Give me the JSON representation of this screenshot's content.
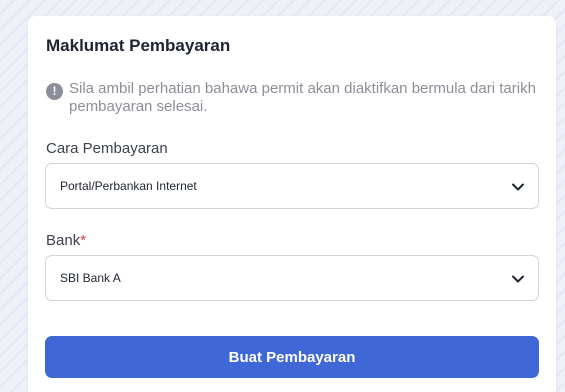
{
  "section": {
    "title": "Maklumat Pembayaran"
  },
  "notice": {
    "icon": "info-icon",
    "icon_glyph": "!",
    "text": "Sila ambil perhatian bahawa permit akan diaktifkan bermula dari tarikh pembayaran selesai."
  },
  "payment_method": {
    "label": "Cara Pembayaran",
    "value": "Portal/Perbankan Internet",
    "icon": "chevron-down-icon"
  },
  "bank": {
    "label": "Bank",
    "required_marker": "*",
    "value": "SBI Bank A",
    "icon": "chevron-down-icon"
  },
  "actions": {
    "submit_label": "Buat Pembayaran"
  },
  "colors": {
    "primary": "#3f68d6",
    "required": "#e53935",
    "muted_text": "#8c8f99"
  }
}
